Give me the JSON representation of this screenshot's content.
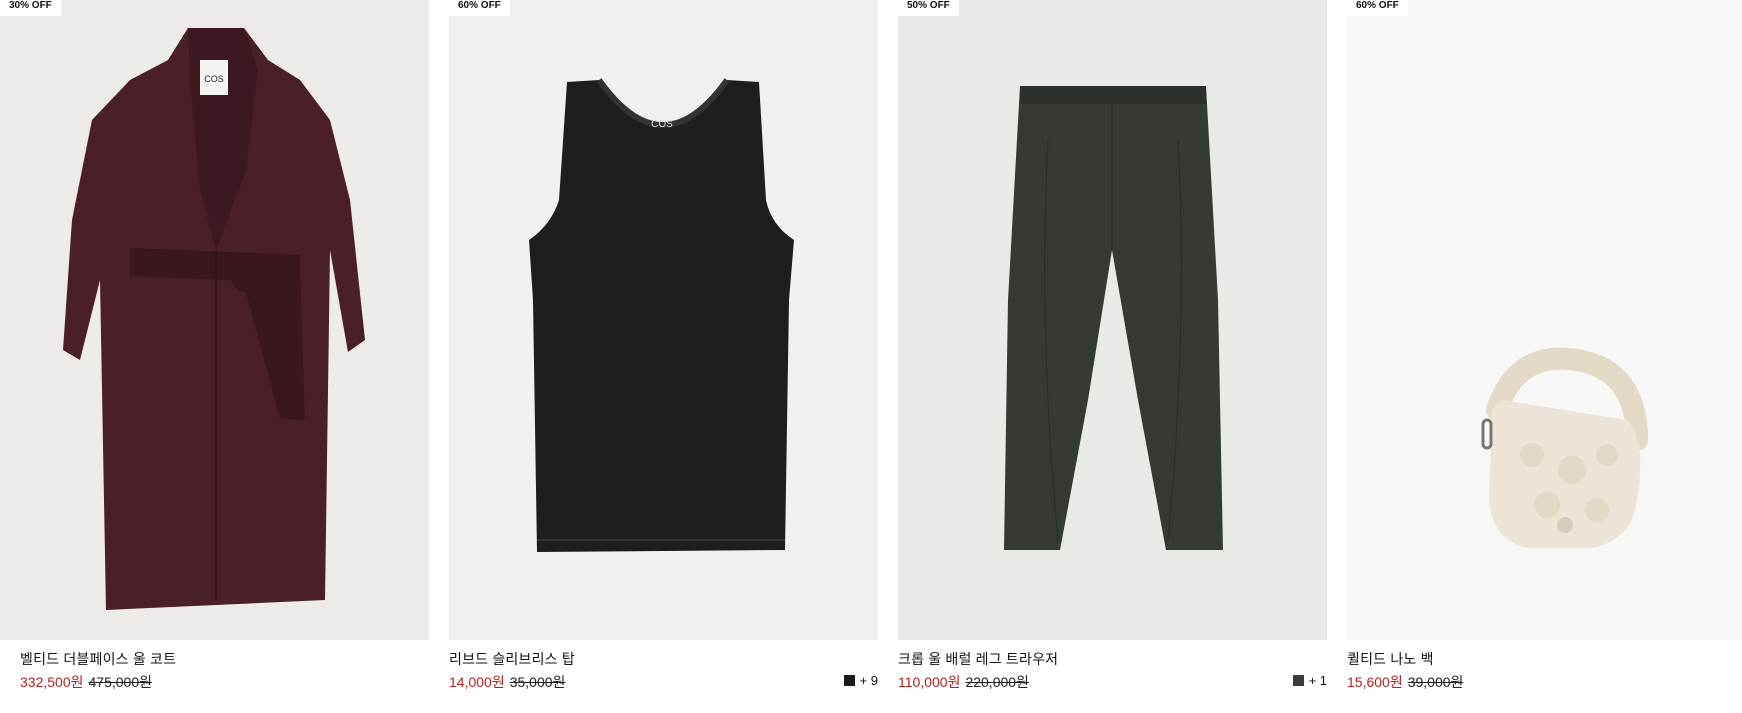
{
  "products": [
    {
      "badge": "30% OFF",
      "name": "벨티드 더블페이스 울 코트",
      "sale_price": "332,500원",
      "original_price": "475,000원",
      "swatch_color": "",
      "more_colors": "",
      "image_icon": "wool-coat-image",
      "image_bg": "#ecebe7"
    },
    {
      "badge": "60% OFF",
      "name": "리브드 슬리브리스 탑",
      "sale_price": "14,000원",
      "original_price": "35,000원",
      "swatch_color": "#1b1b1b",
      "more_colors": "+ 9",
      "image_icon": "tank-top-image",
      "image_bg": "#eef0f1"
    },
    {
      "badge": "50% OFF",
      "name": "크롭 울 배럴 레그 트라우저",
      "sale_price": "110,000원",
      "original_price": "220,000원",
      "swatch_color": "#3a3d39",
      "more_colors": "+ 1",
      "image_icon": "trousers-image",
      "image_bg": "#e9e9e6"
    },
    {
      "badge": "60% OFF",
      "name": "퀼티드 나노 백",
      "sale_price": "15,600원",
      "original_price": "39,000원",
      "swatch_color": "",
      "more_colors": "",
      "image_icon": "quilted-bag-image",
      "image_bg": "#f7f7f7"
    }
  ],
  "colors": {
    "sale_price": "#b22222",
    "coat": "#4a1f27",
    "tank": "#1e1e1e",
    "trousers": "#353a33",
    "bag": "#ece4d6"
  }
}
